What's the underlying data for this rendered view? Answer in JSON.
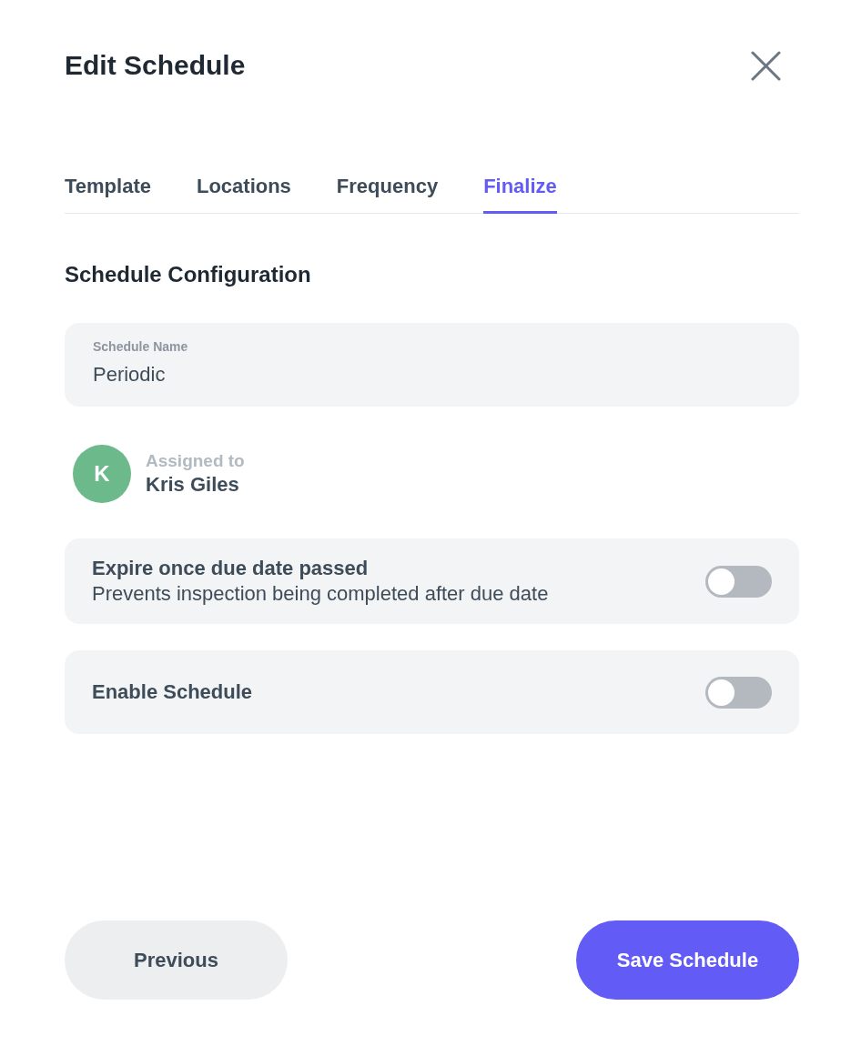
{
  "dialog": {
    "title": "Edit Schedule"
  },
  "tabs": [
    {
      "label": "Template",
      "selected": false
    },
    {
      "label": "Locations",
      "selected": false
    },
    {
      "label": "Frequency",
      "selected": false
    },
    {
      "label": "Finalize",
      "selected": true
    }
  ],
  "section": {
    "heading": "Schedule Configuration"
  },
  "name_field": {
    "label": "Schedule Name",
    "value": "Periodic"
  },
  "assignee": {
    "initial": "K",
    "label": "Assigned to",
    "name": "Kris Giles"
  },
  "settings": [
    {
      "title": "Expire once due date passed",
      "description": "Prevents inspection being completed after due date",
      "on": false
    },
    {
      "title": "Enable Schedule",
      "on": false
    }
  ],
  "buttons": {
    "previous": "Previous",
    "save": "Save Schedule"
  }
}
